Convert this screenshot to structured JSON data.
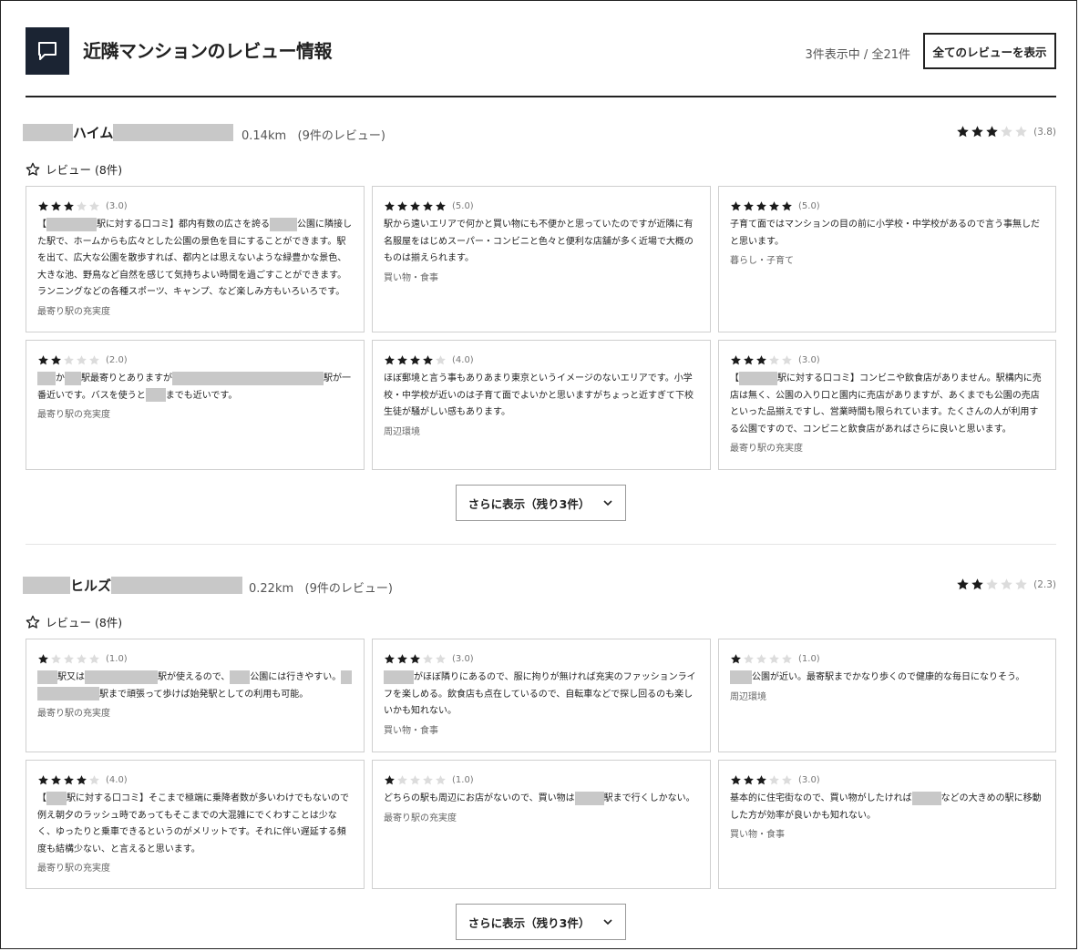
{
  "header": {
    "title": "近隣マンションのレビュー情報",
    "count": "3件表示中 / 全21件",
    "all_button": "全てのレビューを表示"
  },
  "mansions": [
    {
      "name_mid": "ハイム",
      "distance": "0.14km",
      "review_count": "(9件のレビュー)",
      "rating_stars": 3,
      "rating_score": "(3.8)",
      "reviews_label": "レビュー (8件)",
      "more_button": "さらに表示（残り3件）",
      "cards": [
        {
          "stars": 3,
          "score": "(3.0)",
          "text_parts": [
            "【",
            "駅に対する口コミ】都内有数の広さを誇る",
            "公園に隣接した駅で、ホームからも広々とした公園の景色を目にすることができます。駅を出て、広大な公園を散歩すれば、都内とは思えないような緑豊かな景色、大きな池、野鳥など自然を感じて気持ちよい時間を過ごすことができます。ランニングなどの各種スポーツ、キャンプ、など楽しみ方もいろいろです。"
          ],
          "category": "最寄り駅の充実度"
        },
        {
          "stars": 5,
          "score": "(5.0)",
          "text_parts": [
            "駅から遠いエリアで何かと買い物にも不便かと思っていたのですが近隣に有名服屋をはじめスーパー・コンビニと色々と便利な店舗が多く近場で大概のものは揃えられます。"
          ],
          "category": "買い物・食事"
        },
        {
          "stars": 5,
          "score": "(5.0)",
          "text_parts": [
            "子育て面ではマンションの目の前に小学校・中学校があるので言う事無しだと思います。"
          ],
          "category": "暮らし・子育て"
        },
        {
          "stars": 2,
          "score": "(2.0)",
          "text_parts": [
            "",
            "か",
            "駅最寄りとありますが",
            "駅が一番近いです。バスを使うと",
            "までも近いです。"
          ],
          "category": "最寄り駅の充実度"
        },
        {
          "stars": 4,
          "score": "(4.0)",
          "text_parts": [
            "ほぼ郵境と言う事もありあまり東京というイメージのないエリアです。小学校・中学校が近いのは子育て面でよいかと思いますがちょっと近すぎて下校生徒が騒がしい感もあります。"
          ],
          "category": "周辺環境"
        },
        {
          "stars": 3,
          "score": "(3.0)",
          "text_parts": [
            "【",
            "駅に対する口コミ】コンビニや飲食店がありません。駅構内に売店は無く、公園の入り口と園内に売店がありますが、あくまでも公園の売店といった品揃えですし、営業時間も限られています。たくさんの人が利用する公園ですので、コンビニと飲食店があればさらに良いと思います。"
          ],
          "category": "最寄り駅の充実度"
        }
      ]
    },
    {
      "name_mid": "ヒルズ",
      "distance": "0.22km",
      "review_count": "(9件のレビュー)",
      "rating_stars": 2,
      "rating_score": "(2.3)",
      "reviews_label": "レビュー (8件)",
      "more_button": "さらに表示（残り3件）",
      "cards": [
        {
          "stars": 1,
          "score": "(1.0)",
          "text_parts": [
            "",
            "駅又は",
            "駅が使えるので、",
            "公園には行きやすい。",
            "",
            "駅まで頑張って歩けば始発駅としての利用も可能。"
          ],
          "category": "最寄り駅の充実度"
        },
        {
          "stars": 3,
          "score": "(3.0)",
          "text_parts": [
            "",
            "がほぼ隣りにあるので、服に拘りが無ければ充実のファッションライフを楽しめる。飲食店も点在しているので、自転車などで探し回るのも楽しいかも知れない。"
          ],
          "category": "買い物・食事"
        },
        {
          "stars": 1,
          "score": "(1.0)",
          "text_parts": [
            "",
            "公園が近い。最寄駅までかなり歩くので健康的な毎日になりそう。"
          ],
          "category": "周辺環境"
        },
        {
          "stars": 4,
          "score": "(4.0)",
          "text_parts": [
            "【",
            "駅に対する口コミ】そこまで極端に乗降者数が多いわけでもないので例え朝夕のラッシュ時であってもそこまでの大混雑にでくわすことは少なく、ゆったりと乗車できるというのがメリットです。それに伴い遅延する頻度も結構少ない、と言えると思います。"
          ],
          "category": "最寄り駅の充実度"
        },
        {
          "stars": 1,
          "score": "(1.0)",
          "text_parts": [
            "どちらの駅も周辺にお店がないので、買い物は",
            "駅まで行くしかない。"
          ],
          "category": "最寄り駅の充実度"
        },
        {
          "stars": 3,
          "score": "(3.0)",
          "text_parts": [
            "基本的に住宅街なので、買い物がしたければ",
            "などの大きめの駅に移動した方が効率が良いかも知れない。"
          ],
          "category": "買い物・食事"
        }
      ]
    }
  ]
}
